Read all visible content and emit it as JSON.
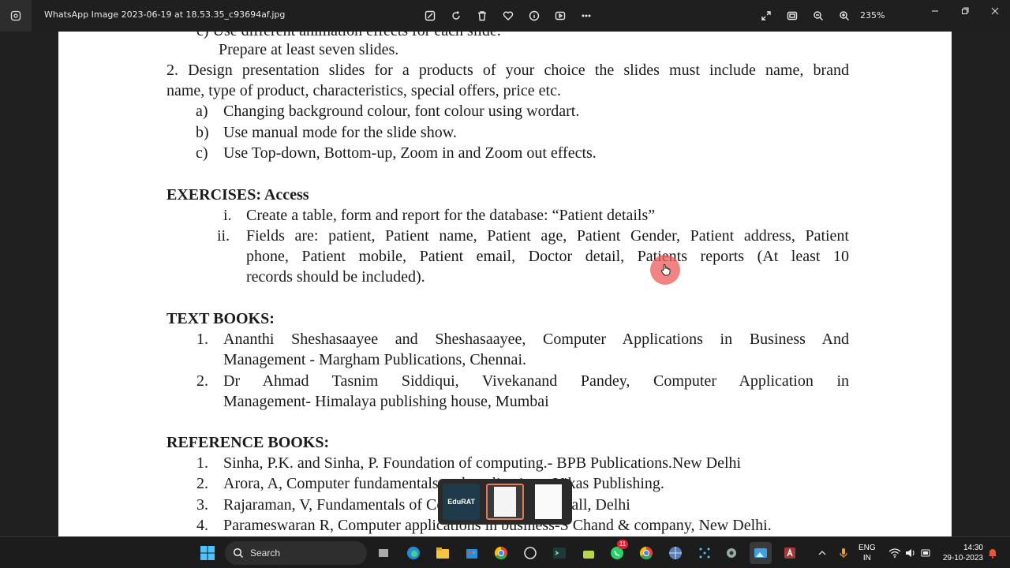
{
  "window": {
    "title": "WhatsApp Image 2023-06-19 at 18.53.35_c93694af.jpg",
    "zoom": "235%"
  },
  "toolbar": {
    "icons": [
      "edit-icon",
      "rotate-icon",
      "delete-icon",
      "favorite-icon",
      "info-icon",
      "slideshow-icon",
      "more-icon"
    ],
    "right_icons": [
      "expand-icon",
      "fit-icon",
      "zoom-out-icon",
      "zoom-in-icon"
    ]
  },
  "document": {
    "cut_line": "c)   Use different animation effects for each slide.",
    "prepare": "Prepare at least seven slides.",
    "item2_line1": "2. Design presentation slides for a products of your choice the slides must include name, brand",
    "item2_line2": "name, type of product, characteristics, special offers, price etc.",
    "sub_a_label": "a)",
    "sub_a": "Changing background colour, font colour using wordart.",
    "sub_b_label": "b)",
    "sub_b": "Use manual mode for the slide show.",
    "sub_c_label": "c)",
    "sub_c": "Use Top-down, Bottom-up, Zoom in and Zoom out effects.",
    "exercises_heading": "EXERCISES:  Access",
    "ex_i_label": "i.",
    "ex_i": "Create a table, form and report for the database: “Patient details”",
    "ex_ii_label": "ii.",
    "ex_ii_line1": "Fields are: patient, Patient name, Patient age, Patient Gender, Patient address, Patient",
    "ex_ii_line2": "phone, Patient mobile, Patient email, Doctor detail, Patients reports (At least 10",
    "ex_ii_line3": "records should be included).",
    "textbooks_heading": "TEXT BOOKS:",
    "tb1_label": "1.",
    "tb1_line1": "Ananthi Sheshasaayee and Sheshasaayee, Computer Applications in Business And",
    "tb1_line2": "Management - Margham Publications, Chennai.",
    "tb2_label": "2.",
    "tb2_line1": "Dr Ahmad Tasnim Siddiqui, Vivekanand Pandey, Computer Application in",
    "tb2_line2": "Management- Himalaya publishing house, Mumbai",
    "reference_heading": "REFERENCE BOOKS:",
    "rb1_label": "1.",
    "rb1": "Sinha, P.K. and Sinha, P. Foundation of computing.- BPB Publications.New Delhi",
    "rb2_label": "2.",
    "rb2": "Arora, A, Computer fundamentals and applications. Vikas Publishing.",
    "rb3_label": "3.",
    "rb3": "Rajaraman, V, Fundamentals of Computers. Prentice-Hall, Delhi",
    "rb4_label": "4.",
    "rb4": "Parameswaran R, Computer applications in business-S Chand & company, New Delhi."
  },
  "thumbnail_popup": {
    "first_label": "EduRAT"
  },
  "taskbar": {
    "search_label": "Search",
    "whatsapp_badge": "11",
    "lang_line1": "ENG",
    "lang_line2": "IN",
    "time": "14:30",
    "date": "29-10-2023"
  }
}
